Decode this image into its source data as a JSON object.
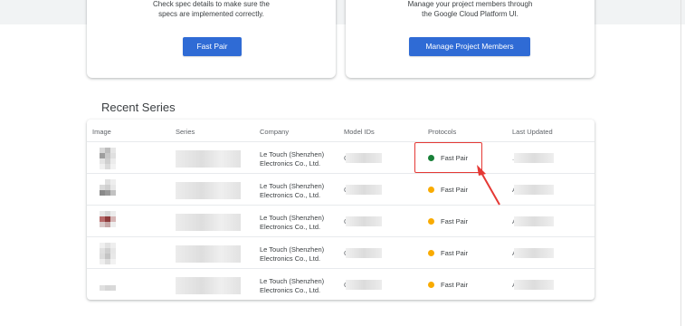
{
  "cards": [
    {
      "description_line1": "Check spec details to make sure the",
      "description_line2": "specs are implemented correctly.",
      "button_label": "Fast Pair"
    },
    {
      "description_line1": "Manage your project members through",
      "description_line2": "the Google Cloud Platform UI.",
      "button_label": "Manage Project Members"
    }
  ],
  "recent_series": {
    "title": "Recent Series",
    "columns": [
      "Image",
      "Series",
      "Company",
      "Model IDs",
      "Protocols",
      "Last Updated"
    ],
    "rows": [
      {
        "company_line1": "Le Touch (Shenzhen)",
        "company_line2": "Electronics Co., Ltd.",
        "protocol": "Fast Pair",
        "status_color": "#188038"
      },
      {
        "company_line1": "Le Touch (Shenzhen)",
        "company_line2": "Electronics Co., Ltd.",
        "protocol": "Fast Pair",
        "status_color": "#f9ab00"
      },
      {
        "company_line1": "Le Touch (Shenzhen)",
        "company_line2": "Electronics Co., Ltd.",
        "protocol": "Fast Pair",
        "status_color": "#f9ab00"
      },
      {
        "company_line1": "Le Touch (Shenzhen)",
        "company_line2": "Electronics Co., Ltd.",
        "protocol": "Fast Pair",
        "status_color": "#f9ab00"
      },
      {
        "company_line1": "Le Touch (Shenzhen)",
        "company_line2": "Electronics Co., Ltd.",
        "protocol": "Fast Pair",
        "status_color": "#f9ab00"
      }
    ]
  },
  "colors": {
    "primary_button": "#2f6bd5",
    "annotation": "#e53935"
  }
}
